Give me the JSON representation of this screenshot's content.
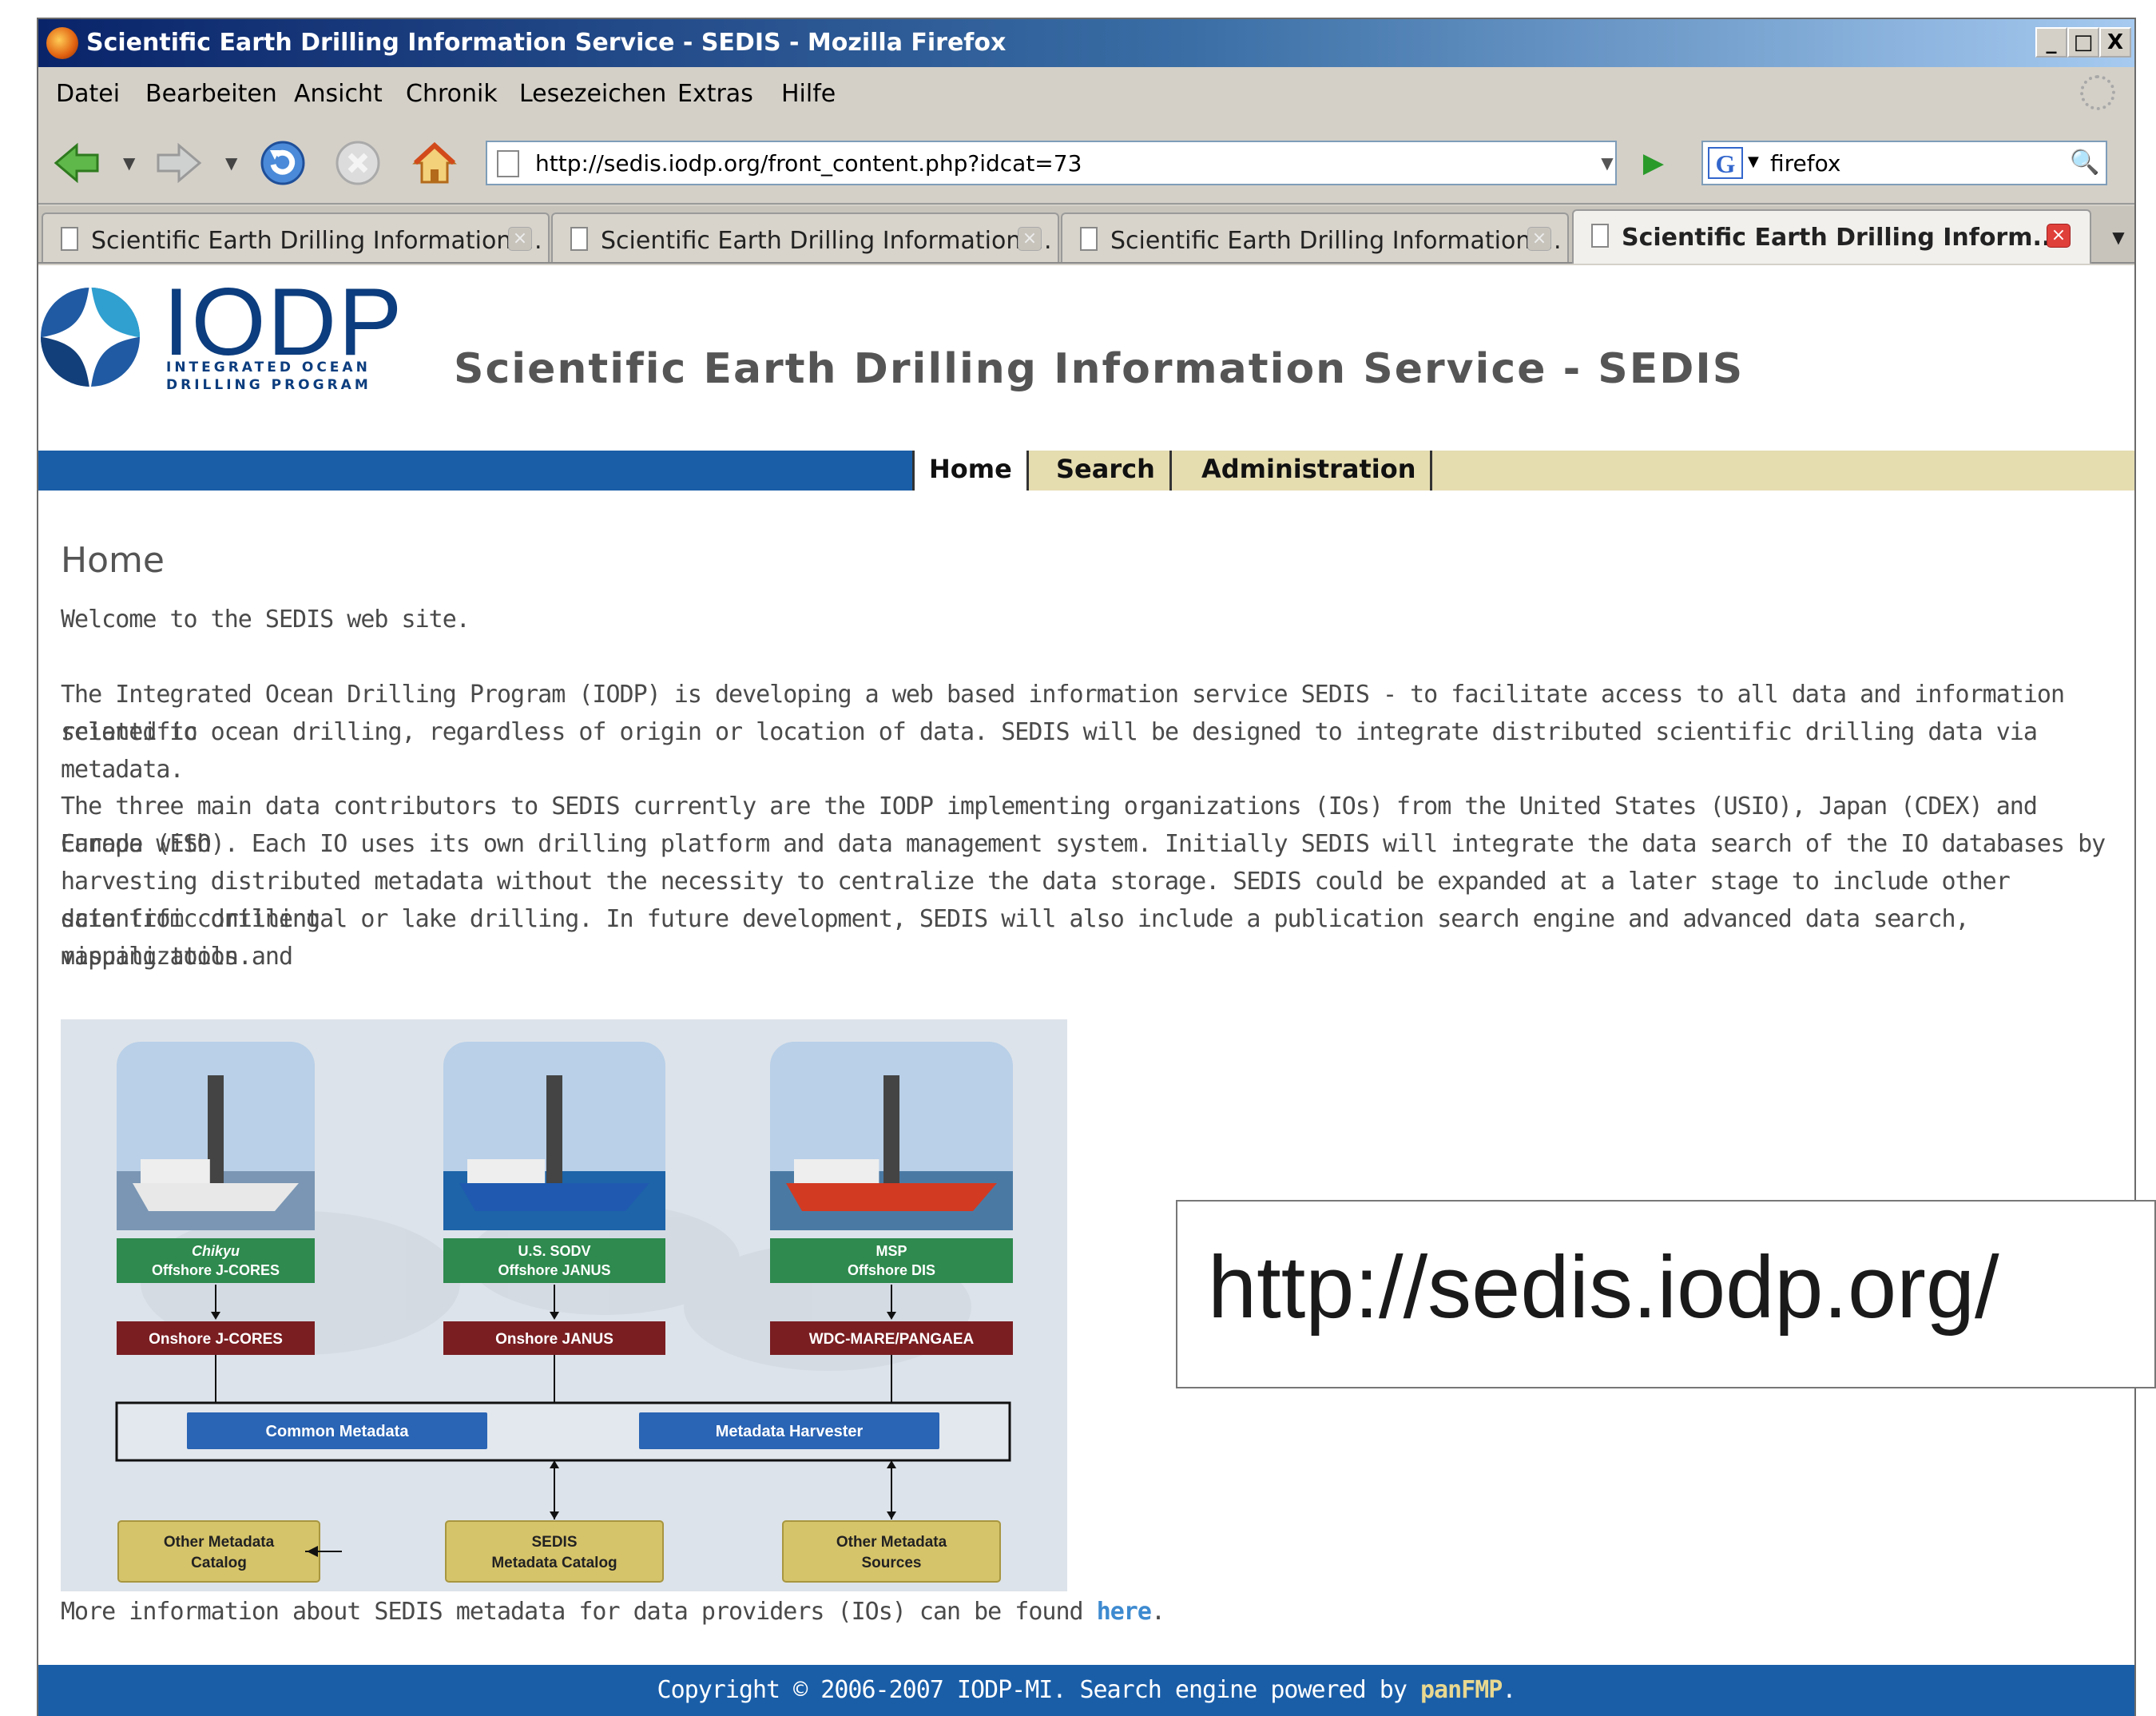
{
  "browser": {
    "window_title": "Scientific Earth Drilling Information Service - SEDIS - Mozilla Firefox",
    "window_buttons": [
      "_",
      "□",
      "X"
    ],
    "menu": [
      {
        "label": "Datei"
      },
      {
        "label": "Bearbeiten"
      },
      {
        "label": "Ansicht"
      },
      {
        "label": "Chronik"
      },
      {
        "label": "Lesezeichen"
      },
      {
        "label": "Extras"
      },
      {
        "label": "Hilfe"
      }
    ],
    "url": "http://sedis.iodp.org/front_content.php?idcat=73",
    "search_engine": "G",
    "search_value": "firefox",
    "tabs": [
      {
        "label": "Scientific Earth Drilling Information ..."
      },
      {
        "label": "Scientific Earth Drilling Information ..."
      },
      {
        "label": "Scientific Earth Drilling Information ..."
      },
      {
        "label": "Scientific Earth Drilling Inform..."
      }
    ],
    "active_tab": 3
  },
  "site": {
    "logo_text": "IODP",
    "logo_sub1": "INTEGRATED OCEAN",
    "logo_sub2": "DRILLING PROGRAM",
    "title": "Scientific Earth Drilling Information Service - SEDIS",
    "nav": [
      {
        "label": "Home"
      },
      {
        "label": "Search"
      },
      {
        "label": "Administration"
      }
    ],
    "active_nav": 0,
    "heading": "Home",
    "welcome": "Welcome to the SEDIS web site.",
    "para1_line1": "The Integrated Ocean Drilling Program (IODP) is developing a web based information service SEDIS - to facilitate access to all data and information related to",
    "para1_line2": "scientific ocean drilling, regardless of origin or location of data. SEDIS will be designed to integrate distributed scientific drilling data via metadata.",
    "para2_lines": [
      "The three main data contributors to SEDIS currently are the IODP implementing organizations (IOs) from the United States (USIO), Japan (CDEX) and Europe with",
      "Canada (ESO). Each IO uses its own drilling platform and data management system. Initially SEDIS will integrate the data search of the IO databases by",
      "harvesting distributed metadata without the necessity to centralize the data storage. SEDIS could be expanded at a later stage to include other scientific drilling",
      "data from continental or lake drilling. In future development, SEDIS will also include a publication search engine and advanced data search, visualization and",
      "mapping tools."
    ],
    "more_info_prefix": "More information about SEDIS metadata for data providers (IOs) can be found ",
    "more_info_link": "here",
    "more_info_suffix": ".",
    "footer_prefix": "Copyright © 2006-2007 IODP-MI. Search engine powered by ",
    "footer_link": "panFMP",
    "footer_suffix": "."
  },
  "diagram": {
    "ships": [
      {
        "name_line1": "Chikyu",
        "name_line2": "Offshore J-CORES",
        "onshore": "Onshore J-CORES",
        "hull": "#e8e8e8",
        "sea": "#7a96b4"
      },
      {
        "name_line1": "U.S. SODV",
        "name_line2": "Offshore JANUS",
        "onshore": "Onshore JANUS",
        "hull": "#1f5ab0",
        "sea": "#1d64a8"
      },
      {
        "name_line1": "MSP",
        "name_line2": "Offshore DIS",
        "onshore": "WDC-MARE/PANGAEA",
        "hull": "#d23a22",
        "sea": "#4a7aa4"
      }
    ],
    "common_metadata": "Common Metadata",
    "metadata_harvester": "Metadata Harvester",
    "bottom": [
      {
        "line1": "Other Metadata",
        "line2": "Catalog"
      },
      {
        "line1": "SEDIS",
        "line2": "Metadata Catalog"
      },
      {
        "line1": "Other Metadata",
        "line2": "Sources"
      }
    ],
    "colors": {
      "green": "#2e8a4e",
      "darkred": "#7a1e22",
      "blue": "#2a64b4",
      "gold": "#d6c46a"
    }
  },
  "overlay_url": "http://sedis.iodp.org/"
}
